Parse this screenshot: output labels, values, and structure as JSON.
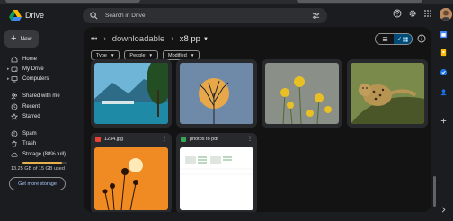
{
  "app": {
    "name": "Drive"
  },
  "search": {
    "placeholder": "Search in Drive"
  },
  "sidebar": {
    "new_label": "New",
    "items": [
      {
        "label": "Home",
        "icon": "home-icon"
      },
      {
        "label": "My Drive",
        "icon": "drive-icon"
      },
      {
        "label": "Computers",
        "icon": "computer-icon"
      },
      {
        "label": "Shared with me",
        "icon": "people-icon"
      },
      {
        "label": "Recent",
        "icon": "clock-icon"
      },
      {
        "label": "Starred",
        "icon": "star-icon"
      },
      {
        "label": "Spam",
        "icon": "spam-icon"
      },
      {
        "label": "Trash",
        "icon": "trash-icon"
      },
      {
        "label": "Storage (88% full)",
        "icon": "cloud-icon"
      }
    ],
    "storage": {
      "used_text": "13.25 GB of 15 GB used",
      "fraction": 0.88
    },
    "get_more_label": "Get more storage"
  },
  "breadcrumb": {
    "overflow": "•••",
    "parent": "downloadable",
    "current": "x8 pp"
  },
  "filters": [
    {
      "label": "Type"
    },
    {
      "label": "People"
    },
    {
      "label": "Modified"
    }
  ],
  "files": [
    {
      "name": "1234.jpg",
      "kind": "image"
    },
    {
      "name": "photos to pdf",
      "kind": "sheet"
    }
  ],
  "colors": {
    "accent": "#a8c7fa",
    "toggle_on": "#004a77",
    "storage_fill": "#e8b04a",
    "image_icon": "#e94235",
    "sheet_icon": "#34a853"
  }
}
